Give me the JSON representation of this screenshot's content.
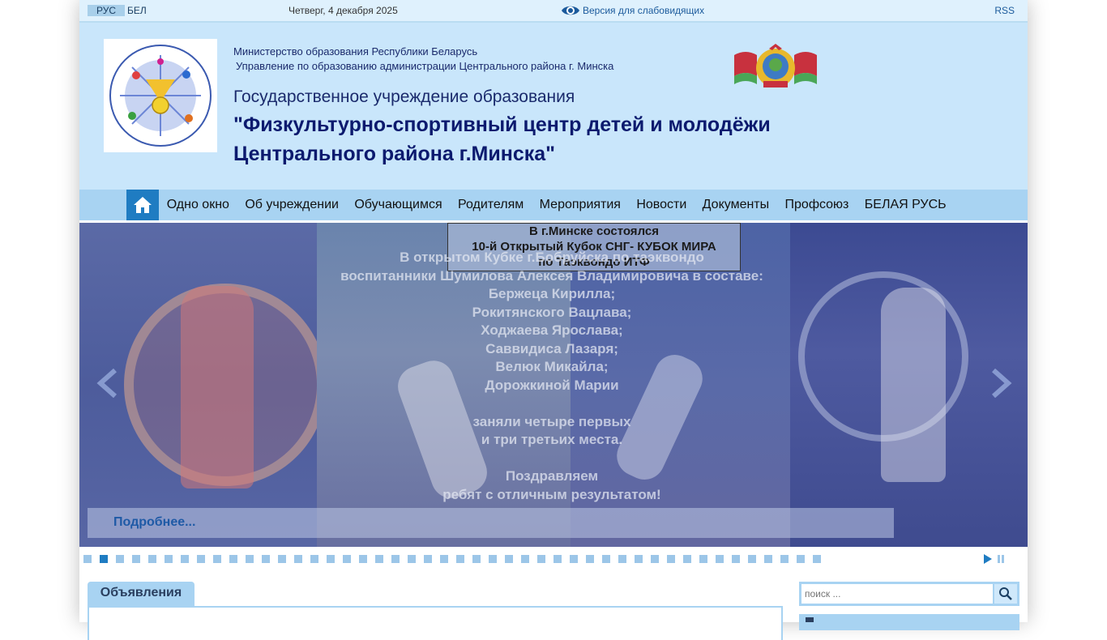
{
  "topbar": {
    "lang_ru": "РУС",
    "lang_by": "БЕЛ",
    "date": "Четверг, 4 декабря 2025",
    "vision_label": "Версия для слабовидящих",
    "rss": "RSS"
  },
  "header": {
    "ministry": "Министерство образования Республики Беларусь",
    "department": "Управление по образованию администрации Центрального района г. Минска",
    "institution_type": "Государственное учреждение образования",
    "institution_name": "\"Физкультурно-спортивный центр детей и молодёжи Центрального района г.Минска\""
  },
  "nav": {
    "items": [
      "Одно окно",
      "Об учреждении",
      "Обучающимся",
      "Родителям",
      "Мероприятия",
      "Новости",
      "Документы",
      "Профсоюз",
      "БЕЛАЯ РУСЬ"
    ]
  },
  "slider": {
    "caption_lines": [
      "В г.Минске состоялся",
      "10-й Открытый Кубок СНГ- КУБОК МИРА",
      "по Таэквондо ИТФ"
    ],
    "overlay_lines": [
      "В открытом Кубке г.Бобруйска по таэквондо",
      "воспитанники Шумилова Алексея Владимировича в составе:",
      "Бержеца Кирилла;",
      "Рокитянского Вацлава;",
      "Ходжаева Ярослава;",
      "Саввидиса Лазаря;",
      "Велюк Микайла;",
      "Дорожкиной Марии",
      "",
      "заняли четыре первых",
      "и три третьих места.",
      "",
      "Поздравляем",
      "ребят с отличным результатом!"
    ],
    "more_label": "Подробнее...",
    "dot_count": 46,
    "active_dot": 1
  },
  "announcements": {
    "tab_label": "Объявления"
  },
  "search": {
    "placeholder": "поиск ..."
  },
  "colors": {
    "accent": "#1f7cc2",
    "nav_bg": "#a8d3f2",
    "header_bg": "#c9e6fb",
    "title": "#0c1a6e"
  }
}
